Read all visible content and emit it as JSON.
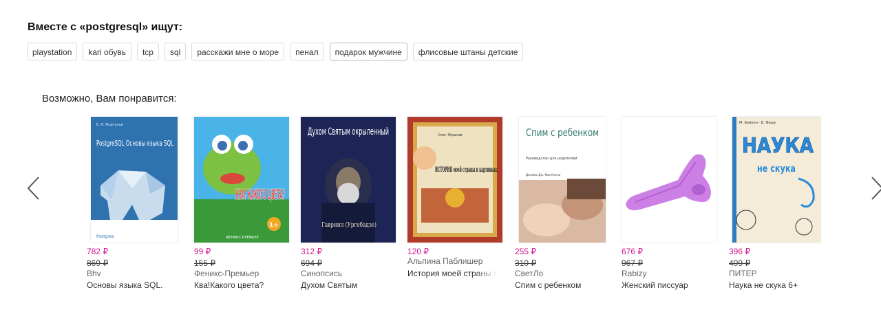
{
  "search_suggestions": {
    "title": "Вместе с «postgresql» ищут:",
    "chips": [
      "playstation",
      "kari обувь",
      "tcp",
      "sql",
      "расскажи мне о море",
      "пенал",
      "подарок мужчине",
      "флисовые штаны детские"
    ]
  },
  "recommendations": {
    "title": "Возможно, Вам понравится:",
    "products": [
      {
        "price": "782 ₽",
        "old_price": "869 ₽",
        "brand": "Bhv",
        "name": "Основы языка SQL.",
        "cover_title": "PostgreSQL Основы языка SQL",
        "cover_author": "Е. П. Моргунов",
        "cover_logo": "Postgres"
      },
      {
        "price": "99 ₽",
        "old_price": "155 ₽",
        "brand": "Феникс-Премьер",
        "name": "Ква!Какого цвета?",
        "cover_title": "КВА! КАКОГО ЦВЕТА?",
        "cover_badge": "1+",
        "cover_logo": "ФЕНИКС-ПРЕМЬЕР"
      },
      {
        "price": "312 ₽",
        "old_price": "694 ₽",
        "brand": "Синопсись",
        "name": "Духом Святым",
        "cover_title": "Духом Святым окрыленный",
        "cover_subtitle": "Гавриил (Ургебадзе)"
      },
      {
        "price": "120 ₽",
        "old_price": "",
        "brand": "Альпина Паблишер",
        "name": "История моей страны в",
        "cover_title": "ИСТОРИЯ моей страны в картинках",
        "cover_author": "Олег Жданов"
      },
      {
        "price": "255 ₽",
        "old_price": "310 ₽",
        "brand": "СветЛо",
        "name": "Спим с ребенком",
        "cover_title": "Спим с ребенком",
        "cover_subtitle": "Руководство для родителей",
        "cover_author": "Джеймс Дж. Мак-Кенна"
      },
      {
        "price": "676 ₽",
        "old_price": "967 ₽",
        "brand": "Rabizy",
        "name": "Женский писсуар"
      },
      {
        "price": "396 ₽",
        "old_price": "409 ₽",
        "brand": "ПИТЕР",
        "name": "Наука не скука 6+",
        "cover_title": "НАУКА",
        "cover_subtitle": "не скука",
        "cover_author": "М. Бейнон · Б. Фишу"
      }
    ]
  },
  "colors": {
    "price": "#d1148f",
    "old_price": "#444444",
    "brand": "#666666"
  },
  "icons": {
    "prev": "chevron-left-icon",
    "next": "chevron-right-icon"
  }
}
